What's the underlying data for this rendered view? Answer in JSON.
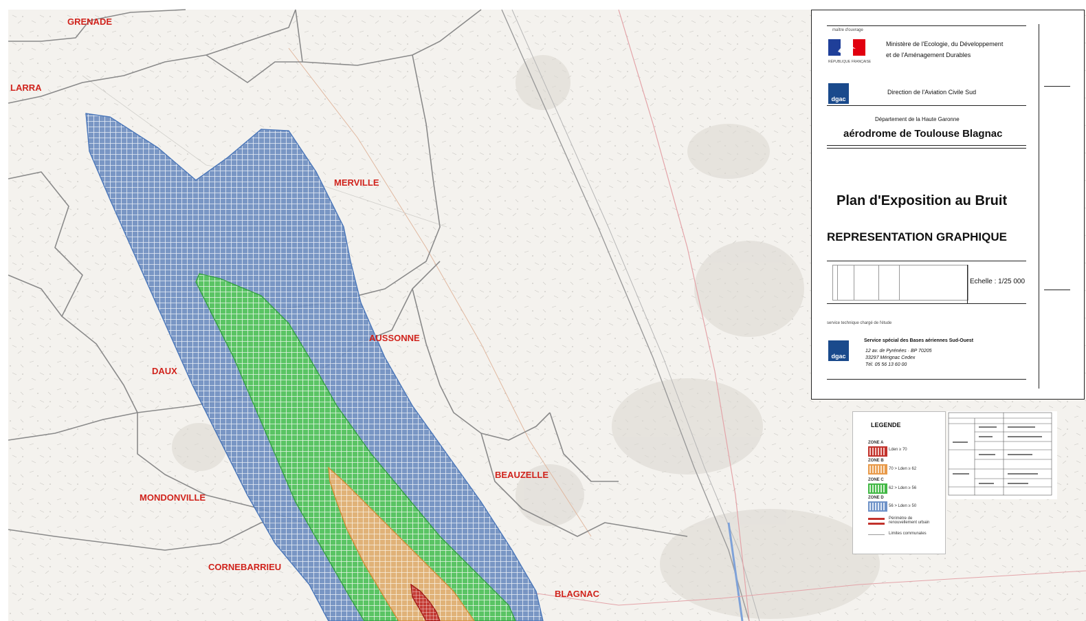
{
  "communes": [
    {
      "id": "grenade",
      "name": "GRENADE"
    },
    {
      "id": "larra",
      "name": "LARRA"
    },
    {
      "id": "merville",
      "name": "MERVILLE"
    },
    {
      "id": "aussonne",
      "name": "AUSSONNE"
    },
    {
      "id": "daux",
      "name": "DAUX"
    },
    {
      "id": "beauzelle",
      "name": "BEAUZELLE"
    },
    {
      "id": "mondonville",
      "name": "MONDONVILLE"
    },
    {
      "id": "cornebarrieu",
      "name": "CORNEBARRIEU"
    },
    {
      "id": "blagnac",
      "name": "BLAGNAC"
    }
  ],
  "cartouche": {
    "maitre_ouvrage": "maître d'ouvrage",
    "ministere_line1": "Ministère de l'Ecologie, du Développement",
    "ministere_line2": "et de l'Aménagement Durables",
    "republique": "RÉPUBLIQUE FRANÇAISE",
    "dgac_logo": "dgac",
    "direction": "Direction de l'Aviation Civile Sud",
    "departement": "Département de la Haute Garonne",
    "aerodrome": "aérodrome de Toulouse Blagnac",
    "plan_title": "Plan d'Exposition au Bruit",
    "representation": "REPRESENTATION GRAPHIQUE",
    "echelle": "Echelle : 1/25 000",
    "service_technique": "service technique chargé de l'étude",
    "service_name": "Service spécial des Bases aériennes Sud-Ouest",
    "address_line1": "12 av. de Pyrénées · BP 70205",
    "address_line2": "33297 Mérignac Cedex",
    "address_line3": "Tél. 05 56 13 60 00"
  },
  "legend": {
    "title": "LEGENDE",
    "zones": [
      {
        "zone": "ZONE A",
        "text": "Lden ≥ 70",
        "color": "#c2322c"
      },
      {
        "zone": "ZONE B",
        "text": "70 > Lden ≥ 62",
        "color": "#e89a4a"
      },
      {
        "zone": "ZONE C",
        "text": "62 > Lden ≥ 56",
        "color": "#42b846"
      },
      {
        "zone": "ZONE D",
        "text": "56 > Lden ≥ 50",
        "color": "#6e92c8"
      }
    ],
    "perimetre": "Périmètre de renouvellement urbain",
    "limites": "Limites communales"
  },
  "colors": {
    "zone_a": "#c2322c",
    "zone_b": "#e6a25a",
    "zone_c": "#4cc34f",
    "zone_d": "#5b7fb7",
    "commune_label": "#d0231c",
    "boundary": "#8a8a8a"
  }
}
